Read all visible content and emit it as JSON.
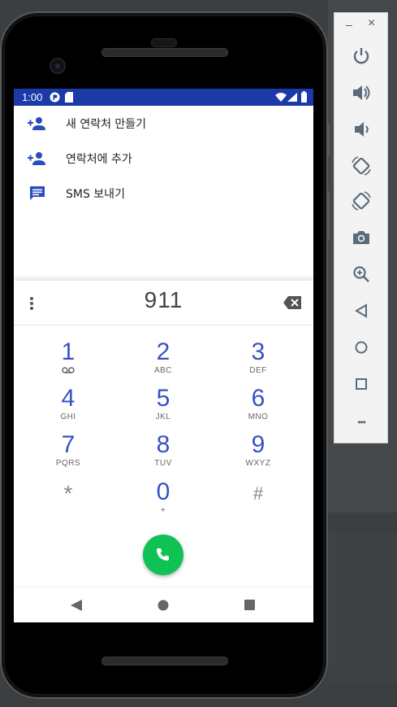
{
  "statusbar": {
    "time": "1:00"
  },
  "suggestions": [
    {
      "label": "새 연락처 만들기",
      "icon": "add-person-icon"
    },
    {
      "label": "연락처에 추가",
      "icon": "add-person-icon"
    },
    {
      "label": "SMS 보내기",
      "icon": "message-icon"
    }
  ],
  "dialpad": {
    "number": "911",
    "keys": [
      {
        "digit": "1",
        "letters": ""
      },
      {
        "digit": "2",
        "letters": "ABC"
      },
      {
        "digit": "3",
        "letters": "DEF"
      },
      {
        "digit": "4",
        "letters": "GHI"
      },
      {
        "digit": "5",
        "letters": "JKL"
      },
      {
        "digit": "6",
        "letters": "MNO"
      },
      {
        "digit": "7",
        "letters": "PQRS"
      },
      {
        "digit": "8",
        "letters": "TUV"
      },
      {
        "digit": "9",
        "letters": "WXYZ"
      },
      {
        "digit": "*",
        "letters": ""
      },
      {
        "digit": "0",
        "letters": "+"
      },
      {
        "digit": "#",
        "letters": ""
      }
    ]
  },
  "toolbar": {
    "minimize": "–",
    "close": "×",
    "more": "•••"
  },
  "colors": {
    "statusbar": "#1b3aa8",
    "accent": "#3552c4",
    "call": "#0ec254"
  }
}
